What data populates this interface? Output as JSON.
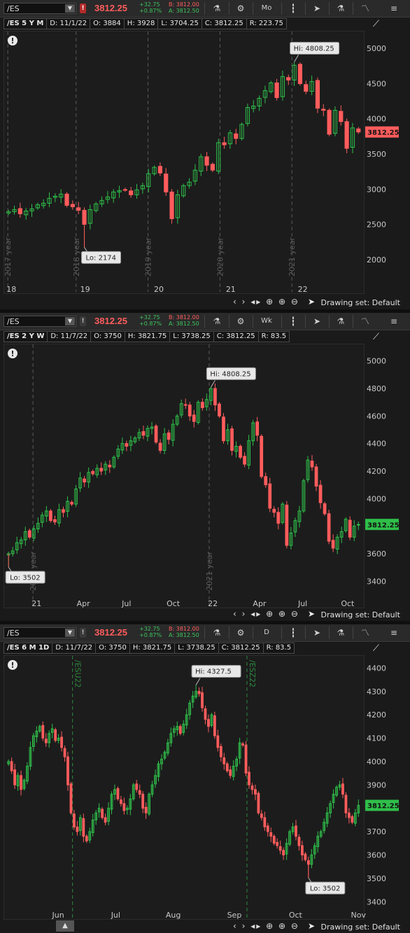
{
  "panels": [
    {
      "id": "p1",
      "symbol": "/ES",
      "alert_glyph": "!",
      "alert_style": "red",
      "last": "3812.25",
      "change": "+32.75",
      "change_pct": "+0.87%",
      "bid": "B: 3812.00",
      "ask": "A: 3812.50",
      "period": "Mo",
      "title": "/ES 5 Y M",
      "date": "D: 11/1/22",
      "open": "O: 3884",
      "high": "H: 3928",
      "low": "L: 3704.25",
      "close": "C: 3812.25",
      "range": "R: 223.75",
      "drawing_set": "Drawing set: Default",
      "hi_label": "Hi: 4808.25",
      "lo_label": "Lo: 2174",
      "price_tag": "3812.25",
      "price_tag_color": "#ff5c5c",
      "chart_data": {
        "type": "candlestick",
        "series": "/ES monthly",
        "ylim": [
          1700,
          5200
        ],
        "yticks": [
          "2000",
          "2500",
          "3000",
          "3500",
          "4000",
          "4500",
          "5000"
        ],
        "yticks_values": [
          2000,
          2500,
          3000,
          3500,
          4000,
          4500,
          5000
        ],
        "xticks": [
          "18",
          "19",
          "20",
          "21",
          "22"
        ],
        "separators": [
          "2017 year",
          "2018 year",
          "2019 year",
          "2020 year",
          "2021 year"
        ],
        "closes": [
          2680,
          2710,
          2650,
          2690,
          2720,
          2780,
          2800,
          2870,
          2900,
          2930,
          2770,
          2750,
          2700,
          2500,
          2710,
          2790,
          2840,
          2890,
          2960,
          2980,
          2990,
          2920,
          2990,
          3050,
          3220,
          3310,
          3230,
          2960,
          2580,
          2920,
          3050,
          3100,
          3270,
          3460,
          3340,
          3270,
          3660,
          3630,
          3800,
          3720,
          3920,
          4160,
          4180,
          4290,
          4400,
          4510,
          4300,
          4600,
          4550,
          4760,
          4500,
          4390,
          4530,
          4150,
          4120,
          3780,
          4120,
          3960,
          3580,
          3870,
          3812
        ],
        "hi": 4808.25,
        "lo": 2174,
        "last": 3812.25
      }
    },
    {
      "id": "p2",
      "symbol": "/ES",
      "alert_glyph": "!",
      "alert_style": "gray",
      "last": "3812.25",
      "change": "+32.75",
      "change_pct": "+0.87%",
      "bid": "B: 3812.00",
      "ask": "A: 3812.50",
      "period": "Wk",
      "title": "/ES 2 Y W",
      "date": "D: 11/7/22",
      "open": "O: 3750",
      "high": "H: 3821.75",
      "low": "L: 3738.25",
      "close": "C: 3812.25",
      "range": "R: 83.5",
      "drawing_set": "Drawing set: Default",
      "hi_label": "Hi: 4808.25",
      "lo_label": "Lo: 3502",
      "price_tag": "3812.25",
      "price_tag_color": "#2fbf4a",
      "chart_data": {
        "type": "candlestick",
        "series": "/ES weekly",
        "ylim": [
          3300,
          5100
        ],
        "yticks": [
          "3400",
          "3600",
          "3800",
          "4000",
          "4200",
          "4400",
          "4600",
          "4800",
          "5000"
        ],
        "yticks_values": [
          3400,
          3600,
          3800,
          4000,
          4200,
          4400,
          4600,
          4800,
          5000
        ],
        "xticks": [
          "21",
          "Apr",
          "Jul",
          "Oct",
          "22",
          "Apr",
          "Jul",
          "Oct"
        ],
        "separators": [
          "2020 year",
          "2021 year"
        ],
        "closes": [
          3600,
          3620,
          3680,
          3700,
          3760,
          3720,
          3780,
          3820,
          3880,
          3910,
          3840,
          3830,
          3920,
          3900,
          3980,
          3960,
          4070,
          4150,
          4120,
          4190,
          4180,
          4220,
          4200,
          4250,
          4230,
          4300,
          4360,
          4400,
          4380,
          4420,
          4440,
          4480,
          4460,
          4510,
          4520,
          4410,
          4350,
          4470,
          4430,
          4540,
          4600,
          4690,
          4680,
          4600,
          4560,
          4700,
          4660,
          4720,
          4800,
          4680,
          4600,
          4420,
          4500,
          4350,
          4380,
          4300,
          4250,
          4420,
          4550,
          4460,
          4160,
          4100,
          3930,
          3900,
          3820,
          3960,
          3660,
          3750,
          3840,
          3910,
          4130,
          4280,
          4230,
          4090,
          3970,
          3890,
          3690,
          3640,
          3720,
          3760,
          3850,
          3720,
          3800,
          3812
        ],
        "hi": 4808.25,
        "lo": 3502,
        "last": 3812.25
      }
    },
    {
      "id": "p3",
      "symbol": "/ES",
      "alert_glyph": "!",
      "alert_style": "gray",
      "last": "3812.25",
      "change": "+32.75",
      "change_pct": "+0.87%",
      "bid": "B: 3812.00",
      "ask": "A: 3812.50",
      "period": "D",
      "title": "/ES 6 M 1D",
      "date": "D: 11/7/22",
      "open": "O: 3750",
      "high": "H: 3821.75",
      "low": "L: 3738.25",
      "close": "C: 3812.25",
      "range": "R: 83.5",
      "drawing_set": "Drawing set: Default",
      "hi_label": "Hi: 4327.5",
      "lo_label": "Lo: 3502",
      "price_tag": "3812.25",
      "price_tag_color": "#2fbf4a",
      "chart_data": {
        "type": "candlestick",
        "series": "/ES daily",
        "ylim": [
          3380,
          4440
        ],
        "yticks": [
          "3400",
          "3500",
          "3600",
          "3700",
          "3800",
          "3900",
          "4000",
          "4100",
          "4200",
          "4300",
          "4400"
        ],
        "yticks_values": [
          3400,
          3500,
          3600,
          3700,
          3800,
          3900,
          4000,
          4100,
          4200,
          4300,
          4400
        ],
        "xticks": [
          "Jun",
          "Jul",
          "Aug",
          "Sep",
          "Oct",
          "Nov"
        ],
        "separators": [
          "/ESU22",
          "/ESZ22"
        ],
        "closes": [
          4000,
          3960,
          3900,
          3940,
          3880,
          3920,
          3980,
          4060,
          4110,
          4130,
          4150,
          4100,
          4080,
          4120,
          4140,
          4090,
          4100,
          4060,
          4020,
          3900,
          3780,
          3720,
          3700,
          3760,
          3680,
          3660,
          3700,
          3750,
          3780,
          3800,
          3760,
          3740,
          3800,
          3860,
          3880,
          3840,
          3820,
          3790,
          3800,
          3840,
          3900,
          3880,
          3860,
          3800,
          3780,
          3860,
          3900,
          3940,
          3990,
          4010,
          4040,
          4080,
          4120,
          4140,
          4150,
          4120,
          4160,
          4200,
          4250,
          4280,
          4300,
          4290,
          4230,
          4180,
          4150,
          4200,
          4110,
          4060,
          4020,
          3990,
          3960,
          3940,
          3980,
          4010,
          4080,
          4070,
          3950,
          3900,
          3880,
          3860,
          3780,
          3760,
          3720,
          3700,
          3680,
          3650,
          3640,
          3620,
          3600,
          3650,
          3700,
          3720,
          3680,
          3640,
          3600,
          3580,
          3560,
          3600,
          3640,
          3680,
          3700,
          3740,
          3780,
          3820,
          3860,
          3890,
          3900,
          3860,
          3780,
          3760,
          3740,
          3780,
          3812
        ],
        "hi": 4327.5,
        "lo": 3502,
        "last": 3812.25
      }
    }
  ],
  "icons": {
    "flask": "flask-icon",
    "gear": "gear-icon",
    "candles": "candlestick-icon",
    "cursor": "cursor-icon",
    "drawing": "drawing-icon",
    "studies": "studies-icon",
    "scale": "auto-scale-icon"
  },
  "colors": {
    "up": "#2fbf4a",
    "down": "#ff5c5c",
    "background": "#1c1c1c",
    "separator": "#5a5a5a",
    "expiry": "#2f8a3f"
  }
}
